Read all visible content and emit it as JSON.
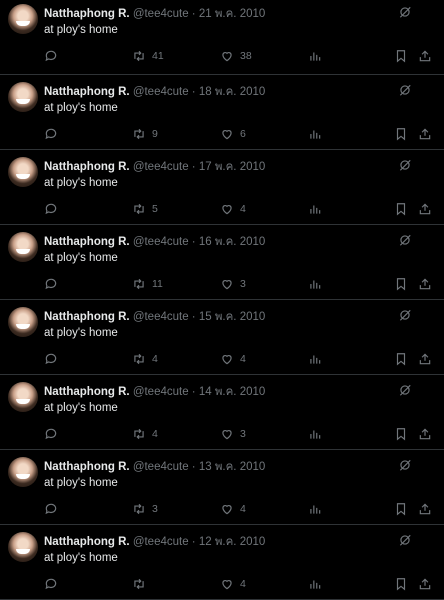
{
  "user": {
    "name": "Natthaphong R.",
    "handle": "@tee4cute"
  },
  "tweets": [
    {
      "date": "21 พ.ค. 2010",
      "text": "at ploy's home",
      "retweets": "41",
      "likes": "38"
    },
    {
      "date": "18 พ.ค. 2010",
      "text": "at ploy's home",
      "retweets": "9",
      "likes": "6"
    },
    {
      "date": "17 พ.ค. 2010",
      "text": "at ploy's home",
      "retweets": "5",
      "likes": "4"
    },
    {
      "date": "16 พ.ค. 2010",
      "text": "at ploy's home",
      "retweets": "11",
      "likes": "3"
    },
    {
      "date": "15 พ.ค. 2010",
      "text": "at ploy's home",
      "retweets": "4",
      "likes": "4"
    },
    {
      "date": "14 พ.ค. 2010",
      "text": "at ploy's home",
      "retweets": "4",
      "likes": "3"
    },
    {
      "date": "13 พ.ค. 2010",
      "text": "at ploy's home",
      "retweets": "3",
      "likes": "4"
    },
    {
      "date": "12 พ.ค. 2010",
      "text": "at ploy's home",
      "retweets": "",
      "likes": "4"
    }
  ],
  "icons": [
    "grok-icon",
    "reply-icon",
    "retweet-icon",
    "like-icon",
    "views-icon",
    "bookmark-icon",
    "share-icon"
  ],
  "colors": {
    "background": "#000000",
    "text": "#e7e9ea",
    "muted": "#71767b",
    "divider": "#2f3336"
  }
}
